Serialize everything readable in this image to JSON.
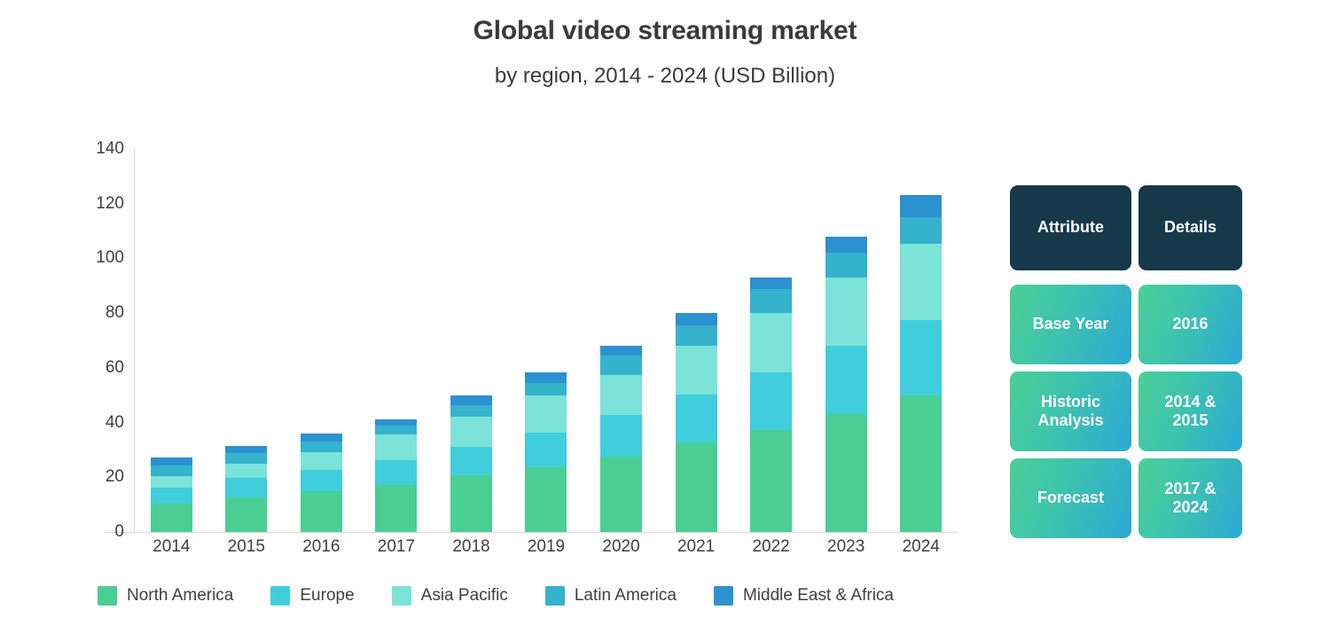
{
  "header": {
    "title": "Global video streaming market",
    "subtitle": "by region, 2014 - 2024 (USD Billion)"
  },
  "chart_data": {
    "type": "bar",
    "stacked": true,
    "title": "Global video streaming market",
    "subtitle": "by region, 2014 - 2024 (USD Billion)",
    "xlabel": "",
    "ylabel": "USD Billion",
    "ylim": [
      0,
      140
    ],
    "yticks": [
      0,
      20,
      40,
      60,
      80,
      100,
      120,
      140
    ],
    "grid": false,
    "legend_position": "bottom",
    "categories": [
      "2014",
      "2015",
      "2016",
      "2017",
      "2018",
      "2019",
      "2020",
      "2021",
      "2022",
      "2023",
      "2024"
    ],
    "series": [
      {
        "name": "North America",
        "color": "#4bce94",
        "values": [
          10.5,
          12.8,
          15.0,
          17.3,
          20.8,
          23.8,
          27.7,
          32.8,
          37.2,
          43.2,
          49.8
        ]
      },
      {
        "name": "Europe",
        "color": "#40cedc",
        "values": [
          5.8,
          6.9,
          7.8,
          9.1,
          10.4,
          12.5,
          15.0,
          17.3,
          21.2,
          24.8,
          27.8
        ]
      },
      {
        "name": "Asia Pacific",
        "color": "#7be3d8",
        "values": [
          4.2,
          5.2,
          6.5,
          9.1,
          11.0,
          13.5,
          14.7,
          18.0,
          21.8,
          25.0,
          27.7
        ]
      },
      {
        "name": "Latin America",
        "color": "#35b2cc",
        "values": [
          3.9,
          3.9,
          3.9,
          3.3,
          4.2,
          4.8,
          7.2,
          7.5,
          8.5,
          9.0,
          9.8
        ]
      },
      {
        "name": "Middle East & Africa",
        "color": "#2b91d0",
        "values": [
          2.9,
          2.5,
          2.8,
          2.3,
          3.6,
          3.6,
          3.6,
          4.4,
          4.3,
          5.8,
          8.2
        ]
      }
    ],
    "totals": [
      27.3,
      31.3,
      36.0,
      41.1,
      50.0,
      58.2,
      68.2,
      80.0,
      93.0,
      107.8,
      123.3
    ]
  },
  "legend": {
    "items": [
      {
        "label": "North America",
        "color": "#4bce94"
      },
      {
        "label": "Europe",
        "color": "#40cedc"
      },
      {
        "label": "Asia Pacific",
        "color": "#7be3d8"
      },
      {
        "label": "Latin America",
        "color": "#35b2cc"
      },
      {
        "label": "Middle East & Africa",
        "color": "#2b91d0"
      }
    ]
  },
  "side_table": {
    "header": {
      "attribute": "Attribute",
      "details": "Details"
    },
    "rows": [
      {
        "attribute": "Base Year",
        "details": "2016"
      },
      {
        "attribute": "Historic\nAnalysis",
        "details": "2014 &\n2015"
      },
      {
        "attribute": "Forecast",
        "details": "2017 &\n2024"
      }
    ],
    "header_color": "#16384b",
    "row_gradient_from": "#4bcf96",
    "row_gradient_to": "#2ca8d6"
  }
}
